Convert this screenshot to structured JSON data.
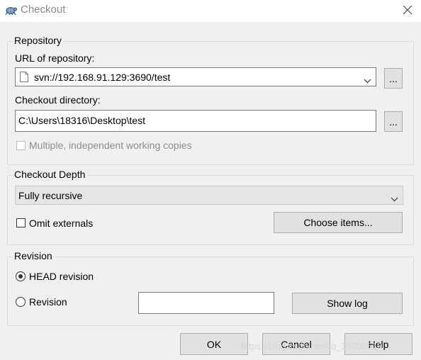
{
  "window": {
    "title": "Checkout"
  },
  "repository": {
    "group_label": "Repository",
    "url_label": "URL of repository:",
    "url_value": "svn://192.168.91.129:3690/test",
    "browse_label": "...",
    "dir_label": "Checkout directory:",
    "dir_value": "C:\\Users\\18316\\Desktop\\test",
    "browse_dir_label": "...",
    "multiple_label": "Multiple, independent working copies",
    "multiple_checked": false
  },
  "depth": {
    "group_label": "Checkout Depth",
    "selected": "Fully recursive",
    "omit_externals_label": "Omit externals",
    "omit_externals_checked": false,
    "choose_items_label": "Choose items..."
  },
  "revision": {
    "group_label": "Revision",
    "head_label": "HEAD revision",
    "head_selected": true,
    "revision_label": "Revision",
    "revision_value": "",
    "show_log_label": "Show log"
  },
  "buttons": {
    "ok": "OK",
    "cancel": "Cancel",
    "help": "Help"
  },
  "watermark": "https://blog.csdn.net/qq_36708510",
  "colors": {
    "accent": "#0078d7",
    "face": "#f0f0f0",
    "button": "#e1e1e1"
  }
}
